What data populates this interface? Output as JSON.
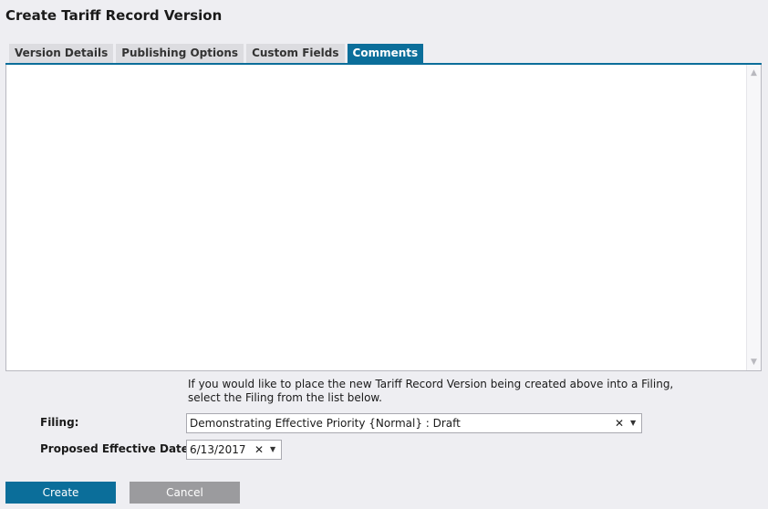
{
  "page_title": "Create Tariff Record Version",
  "tabs": [
    {
      "label": "Version Details",
      "active": false
    },
    {
      "label": "Publishing Options",
      "active": false
    },
    {
      "label": "Custom Fields",
      "active": false
    },
    {
      "label": "Comments",
      "active": true
    }
  ],
  "comments": {
    "value": ""
  },
  "help_text": "If you would like to place the new Tariff Record Version being created above into a Filing, select the Filing from the list below.",
  "filing": {
    "label": "Filing:",
    "value": "Demonstrating Effective Priority {Normal} : Draft",
    "clear_glyph": "✕",
    "dropdown_glyph": "▼"
  },
  "effective_date": {
    "label": "Proposed Effective Date:",
    "value": "6/13/2017",
    "clear_glyph": "✕",
    "dropdown_glyph": "▼"
  },
  "buttons": {
    "create": "Create",
    "cancel": "Cancel"
  },
  "colors": {
    "accent": "#0b6e9a",
    "cancel": "#9b9b9e",
    "background": "#eeeef2"
  }
}
